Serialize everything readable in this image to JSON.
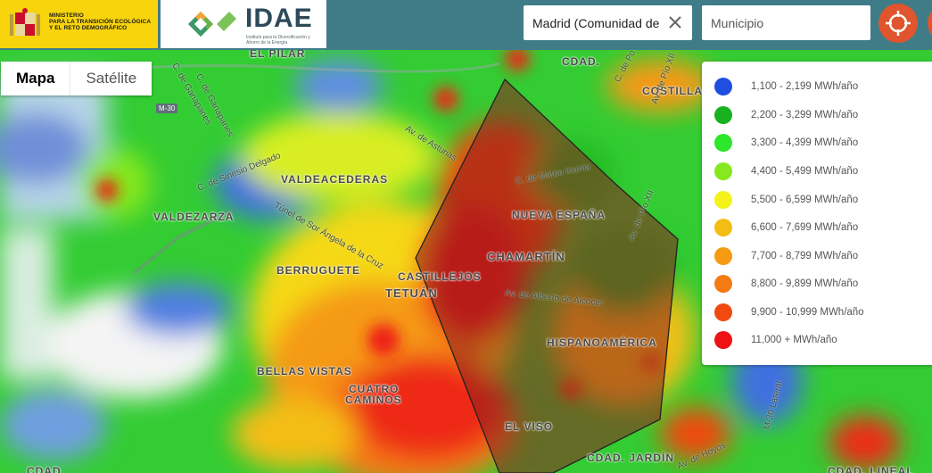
{
  "header": {
    "ministry_logo": {
      "line1": "MINISTERIO",
      "line2": "PARA LA TRANSICIÓN ECOLÓGICA",
      "line3": "Y EL RETO DEMOGRÁFICO"
    },
    "idae_logo": {
      "word": "IDAE",
      "subtitle": "Instituto para la Diversificación y Ahorro de la Energía"
    },
    "region_select": {
      "value": "Madrid (Comunidad de",
      "clear_icon": "close-icon"
    },
    "municipio_input": {
      "placeholder": "Municipio",
      "value": ""
    },
    "locate_icon": "crosshair-icon"
  },
  "map_type": {
    "options": [
      "Mapa",
      "Satélite"
    ],
    "selected": "Mapa"
  },
  "legend": {
    "items": [
      {
        "label": "1,100 - 2,199 MWh/año",
        "color": "#1f4fe0"
      },
      {
        "label": "2,200 - 3,299 MWh/año",
        "color": "#18b21e"
      },
      {
        "label": "3,300 - 4,399 MWh/año",
        "color": "#2ee62a"
      },
      {
        "label": "4,400 - 5,499 MWh/año",
        "color": "#86e81e"
      },
      {
        "label": "5,500 - 6,599 MWh/año",
        "color": "#f3f31a"
      },
      {
        "label": "6,600 - 7,699 MWh/año",
        "color": "#f4bd14"
      },
      {
        "label": "7,700 - 8,799 MWh/año",
        "color": "#f59a12"
      },
      {
        "label": "8,800 - 9,899 MWh/año",
        "color": "#f47a12"
      },
      {
        "label": "9,900 - 10,999 MWh/año",
        "color": "#f04a10"
      },
      {
        "label": "11,000 + MWh/año",
        "color": "#ee1212"
      }
    ]
  },
  "map": {
    "places": [
      {
        "name": "EL PILAR"
      },
      {
        "name": "COSTILLA"
      },
      {
        "name": "VALDEACEDERAS"
      },
      {
        "name": "VALDEZARZA"
      },
      {
        "name": "NUEVA ESPAÑA"
      },
      {
        "name": "CHAMARTÍN"
      },
      {
        "name": "BERRUGUETE"
      },
      {
        "name": "CASTILLEJOS"
      },
      {
        "name": "TETUÁN"
      },
      {
        "name": "HISPANOAMÉRICA"
      },
      {
        "name": "BELLAS VISTAS"
      },
      {
        "name": "CUATRO"
      },
      {
        "name": "CAMINOS"
      },
      {
        "name": "EL VISO"
      },
      {
        "name": "CDAD. JARDÍN"
      },
      {
        "name": "CDAD."
      },
      {
        "name": "CDAD. LINEAL"
      },
      {
        "name": "CDAD"
      }
    ],
    "streets": [
      {
        "name": "C. de Sinesio Delgado"
      },
      {
        "name": "Av. de Asturias"
      },
      {
        "name": "C. de Mateo Inurria"
      },
      {
        "name": "Av. de Pío XII"
      },
      {
        "name": "Túnel de Sor Ángela de la Cruz"
      },
      {
        "name": "Av. de Alberto de Alcocer"
      },
      {
        "name": "C. de Ganapanes"
      },
      {
        "name": "Av. de Pío XII"
      },
      {
        "name": "C. de Po"
      },
      {
        "name": "M-30 Lateral"
      },
      {
        "name": "Av. de Hoyos"
      },
      {
        "name": "C. de Ganapanes"
      }
    ],
    "road_badges": [
      "M-30"
    ],
    "highlighted_district": "CHAMARTÍN"
  }
}
